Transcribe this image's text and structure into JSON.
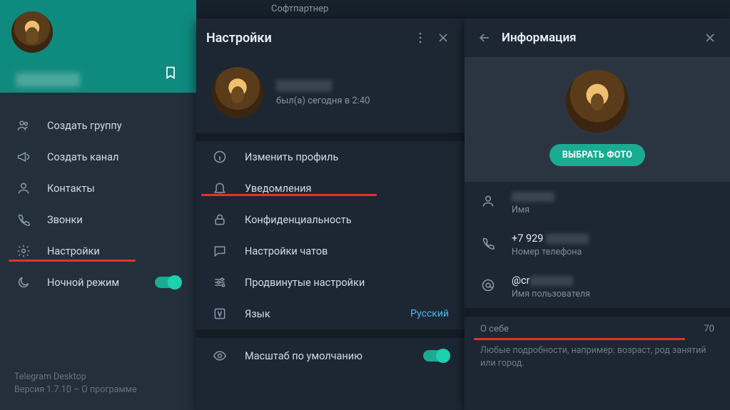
{
  "chat_header": "Софтпартнер",
  "sidebar": {
    "menu": {
      "create_group": "Создать группу",
      "create_channel": "Создать канал",
      "contacts": "Контакты",
      "calls": "Звонки",
      "settings": "Настройки",
      "night_mode": "Ночной режим"
    },
    "footer": {
      "app_name": "Telegram Desktop",
      "version_prefix": "Версия 1.7.10 – ",
      "about": "О программе"
    }
  },
  "settings": {
    "title": "Настройки",
    "status": "был(а) сегодня в 2:40",
    "items": {
      "edit_profile": "Изменить профиль",
      "notifications": "Уведомления",
      "privacy": "Конфиденциальность",
      "chat_settings": "Настройки чатов",
      "advanced": "Продвинутые настройки",
      "language": "Язык",
      "language_value": "Русский",
      "default_scale": "Масштаб по умолчанию"
    }
  },
  "info": {
    "title": "Информация",
    "choose_photo": "ВЫБРАТЬ ФОТО",
    "name_label": "Имя",
    "phone_value": "+7 929",
    "phone_label": "Номер телефона",
    "username_value": "@cr",
    "username_label": "Имя пользователя",
    "about_label": "О себе",
    "about_count": "70",
    "about_hint": "Любые подробности, например: возраст, род занятий или город."
  }
}
